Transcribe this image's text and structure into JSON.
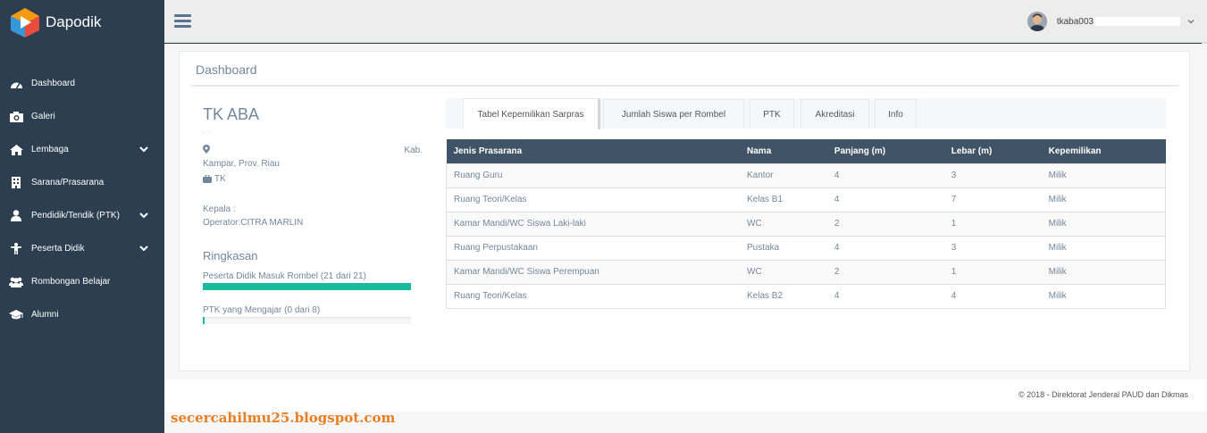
{
  "brand": {
    "name": "Dapodik",
    "color": "#2c3e50"
  },
  "sidebar": {
    "items": [
      {
        "label": "Dashboard",
        "icon": "dashboard-icon",
        "has_children": false
      },
      {
        "label": "Galeri",
        "icon": "camera-icon",
        "has_children": false
      },
      {
        "label": "Lembaga",
        "icon": "home-icon",
        "has_children": true
      },
      {
        "label": "Sarana/Prasarana",
        "icon": "building-icon",
        "has_children": false
      },
      {
        "label": "Pendidik/Tendik (PTK)",
        "icon": "user-icon",
        "has_children": true
      },
      {
        "label": "Peserta Didik",
        "icon": "child-icon",
        "has_children": true
      },
      {
        "label": "Rombongan Belajar",
        "icon": "users-icon",
        "has_children": false
      },
      {
        "label": "Alumni",
        "icon": "graduation-cap-icon",
        "has_children": false
      }
    ]
  },
  "header": {
    "username": "tkaba003"
  },
  "panel": {
    "title": "Dashboard"
  },
  "school": {
    "name": "TK ABA",
    "address_dots": ".       .",
    "address_kab": "Kab.",
    "address_prov": "Kampar, Prov. Riau",
    "jenjang": "TK",
    "kepala": "Kepala    :",
    "operator": "Operator:CITRA MARLIN"
  },
  "ringkasan": {
    "title": "Ringkasan",
    "items": [
      {
        "label": "Peserta Didik Masuk Rombel (21 dari 21)",
        "percent": 100
      },
      {
        "label": "PTK yang Mengajar (0 dari 8)",
        "percent": 1
      }
    ]
  },
  "tabs": [
    {
      "label": "Tabel Kepemilikan Sarpras",
      "active": true
    },
    {
      "label": "Jumlah Siswa per Rombel",
      "active": false
    },
    {
      "label": "PTK",
      "active": false
    },
    {
      "label": "Akreditasi",
      "active": false
    },
    {
      "label": "Info",
      "active": false
    }
  ],
  "table": {
    "headers": [
      "Jenis Prasarana",
      "Nama",
      "Panjang (m)",
      "Lebar (m)",
      "Kepemilikan"
    ],
    "rows": [
      [
        "Ruang Guru",
        "Kantor",
        "4",
        "3",
        "Milik"
      ],
      [
        "Ruang Teori/Kelas",
        "Kelas B1",
        "4",
        "7",
        "Milik"
      ],
      [
        "Kamar Mandi/WC Siswa Laki-laki",
        "WC",
        "2",
        "1",
        "Milik"
      ],
      [
        "Ruang Perpustakaan",
        "Pustaka",
        "4",
        "3",
        "Milik"
      ],
      [
        "Kamar Mandi/WC Siswa Perempuan",
        "WC",
        "2",
        "1",
        "Milik"
      ],
      [
        "Ruang Teori/Kelas",
        "Kelas B2",
        "4",
        "4",
        "Milik"
      ]
    ]
  },
  "footer": {
    "text": "©  2018 - Direktorat Jenderal PAUD dan Dikmas"
  },
  "watermark": "secercahilmu25.blogspot.com",
  "colors": {
    "accent": "#1abb9c",
    "table_header": "#405467",
    "watermark": "#e67e22"
  }
}
